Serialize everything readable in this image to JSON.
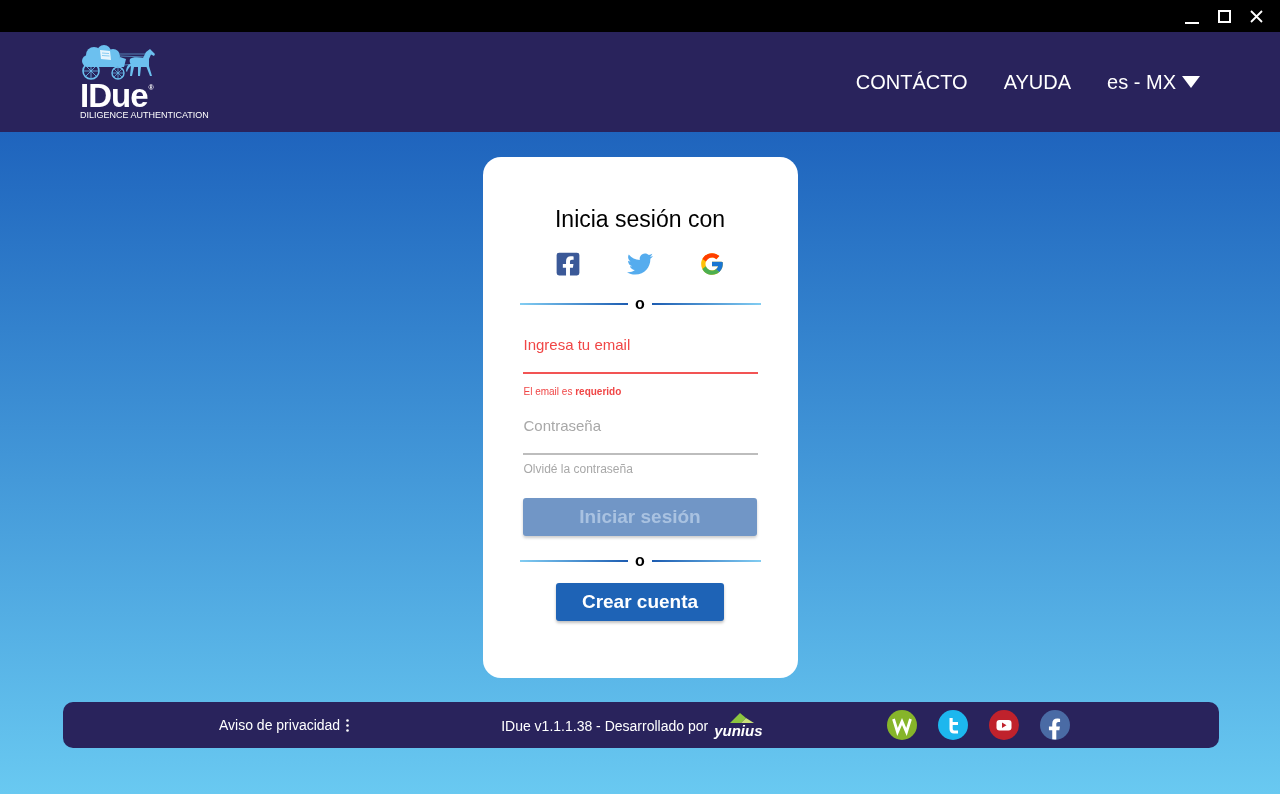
{
  "header": {
    "logo": {
      "name": "IDue$^{®}$",
      "tagline": "DILIGENCE AUTHENTICATION"
    },
    "nav": [
      {
        "label": "CONTÁCTO"
      },
      {
        "label": "AYUDA"
      }
    ],
    "language": {
      "value": "es - MX"
    }
  },
  "login_card": {
    "title": "Inicia sesión con",
    "social_logins": [
      {
        "kind": "facebook"
      },
      {
        "kind": "twitter"
      },
      {
        "kind": "google"
      }
    ],
    "divider_label": "o",
    "email_field": {
      "placeholder": "Ingresa tu email",
      "error": true,
      "error_message": "El email es **requerido**"
    },
    "password_field": {
      "placeholder": "Contraseña"
    },
    "forgot_password": "Olvidé la contraseña",
    "login_button": {
      "label": "Iniciar sesión",
      "disabled": true
    },
    "divider_label_2": "o",
    "create_account_button": {
      "label": "Crear cuenta"
    }
  },
  "footer": {
    "privacy_link": "Aviso de privacidad",
    "version_text": "IDue v1.1.1.38 - Desarrollado por",
    "developer_logo": "yunius",
    "social_links": [
      {
        "kind": "wordpress"
      },
      {
        "kind": "twitter"
      },
      {
        "kind": "youtube"
      },
      {
        "kind": "facebook"
      }
    ]
  }
}
